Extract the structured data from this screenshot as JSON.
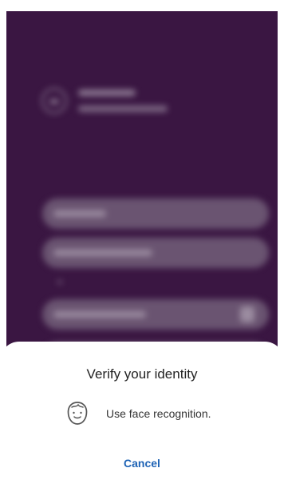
{
  "dialog": {
    "title": "Verify your identity",
    "method": {
      "icon": "face-recognition-icon",
      "label": "Use face recognition."
    },
    "cancel_label": "Cancel"
  },
  "colors": {
    "background": "#3a1642",
    "accent": "#1e63b5"
  }
}
